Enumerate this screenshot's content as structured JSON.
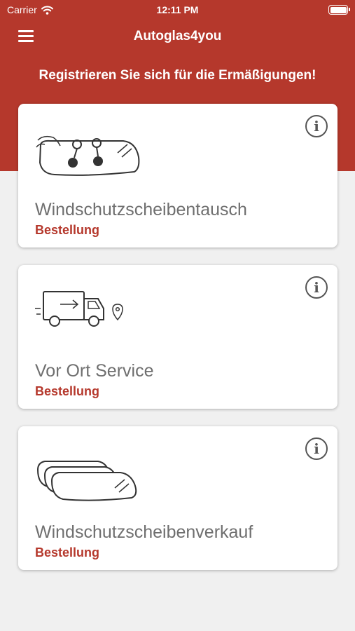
{
  "status_bar": {
    "carrier": "Carrier",
    "time": "12:11 PM"
  },
  "nav": {
    "title": "Autoglas4you",
    "menu_icon": "hamburger-menu-icon"
  },
  "promo_text": "Registrieren Sie sich für die Ermäßigungen!",
  "cards": [
    {
      "title": "Windschutzscheibentausch",
      "subtitle": "Bestellung",
      "info_glyph": "i",
      "icon": "windshield-repair-icon"
    },
    {
      "title": "Vor Ort Service",
      "subtitle": "Bestellung",
      "info_glyph": "i",
      "icon": "delivery-truck-icon"
    },
    {
      "title": "Windschutzscheibenverkauf",
      "subtitle": "Bestellung",
      "info_glyph": "i",
      "icon": "windshields-stack-icon"
    }
  ],
  "colors": {
    "brand": "#b5382c",
    "background": "#f0f0f0",
    "card": "#ffffff",
    "title_gray": "#6f6f6f"
  }
}
